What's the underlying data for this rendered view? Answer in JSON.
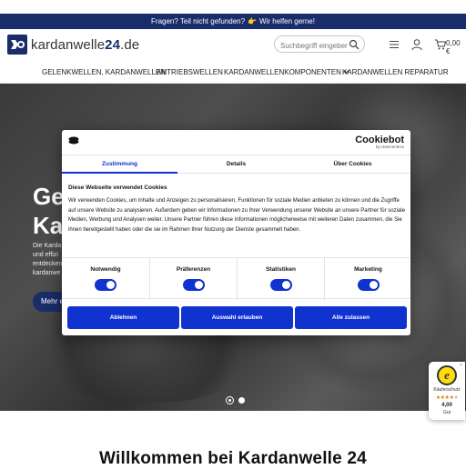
{
  "announcement": {
    "text_before": "Fragen? Teil nicht gefunden?",
    "hand_icon": "pointing-hand-icon",
    "text_after": "Wir helfen gerne!"
  },
  "header": {
    "logo_icon": "kardanwelle-logo-icon",
    "logo_text_main": "kardanwelle",
    "logo_text_accent": "24",
    "logo_text_tld": ".de",
    "search_placeholder": "Suchbegriff eingeben ...",
    "cart_total": "0,00 €"
  },
  "nav": {
    "items": [
      "GELENKWELLEN, KARDANWELLEN",
      "ANTRIEBSWELLEN",
      "KARDANWELLENKOMPONENTEN",
      "KARDANWELLEN REPARATUR"
    ],
    "dropdown_icon": "chevron-down-icon"
  },
  "hero": {
    "title_line1": "Ge",
    "title_line2": "Ka",
    "text_line1": "Die Karda",
    "text_line2": "und effizi",
    "text_line3": "entdecken",
    "text_line4": "kardanwe",
    "button_label": "Mehr e",
    "slides_total": 2,
    "slide_active": 1
  },
  "cookie_dialog": {
    "brand_name": "Cookiebot",
    "brand_by": "by Usercentrics",
    "tabs": [
      "Zustimmung",
      "Details",
      "Über Cookies"
    ],
    "active_tab": "Zustimmung",
    "heading": "Diese Webseite verwendet Cookies",
    "description": "Wir verwenden Cookies, um Inhalte und Anzeigen zu personalisieren, Funktionen für soziale Medien anbieten zu können und die Zugriffe auf unsere Website zu analysieren. Außerdem geben wir Informationen zu Ihrer Verwendung unserer Website an unsere Partner für soziale Medien, Werbung und Analysen weiter. Unsere Partner führen diese Informationen möglicherweise mit weiteren Daten zusammen, die Sie ihnen bereitgestellt haben oder die sie im Rahmen Ihrer Nutzung der Dienste gesammelt haben.",
    "categories": [
      {
        "label": "Notwendig",
        "enabled": true
      },
      {
        "label": "Präferenzen",
        "enabled": true
      },
      {
        "label": "Statistiken",
        "enabled": true
      },
      {
        "label": "Marketing",
        "enabled": true
      }
    ],
    "buttons": {
      "deny": "Ablehnen",
      "allow_selection": "Auswahl erlauben",
      "allow_all": "Alle zulassen"
    },
    "accent_color": "#1032cf"
  },
  "trust_widget": {
    "close": "×",
    "label": "Käuferschutz",
    "rating": 4.0,
    "rating_text": "4,00",
    "grade": "Gut"
  },
  "welcome_heading": "Willkommen bei Kardanwelle 24"
}
